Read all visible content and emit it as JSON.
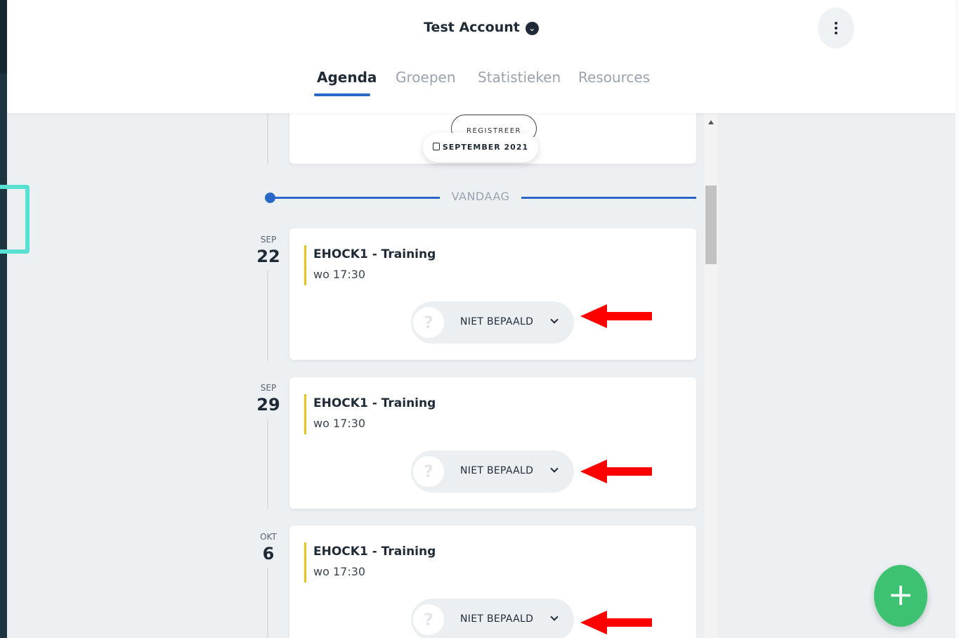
{
  "header": {
    "account_name": "Test Account",
    "account_badge_icon": "chevron-down-circle-icon",
    "more_icon": "more-vertical-icon"
  },
  "tabs": [
    {
      "label": "Agenda",
      "active": true
    },
    {
      "label": "Groepen",
      "active": false
    },
    {
      "label": "Statistieken",
      "active": false
    },
    {
      "label": "Resources",
      "active": false
    }
  ],
  "timeline": {
    "previous_button_label": "REGISTREER",
    "month_pill_label": "SEPTEMBER 2021",
    "today_label": "VANDAAG"
  },
  "events": [
    {
      "month": "SEP",
      "day": "22",
      "title": "EHOCK1 - Training",
      "time": "wo 17:30",
      "status": "NIET BEPAALD",
      "status_icon": "?"
    },
    {
      "month": "SEP",
      "day": "29",
      "title": "EHOCK1 - Training",
      "time": "wo 17:30",
      "status": "NIET BEPAALD",
      "status_icon": "?"
    },
    {
      "month": "OKT",
      "day": "6",
      "title": "EHOCK1 - Training",
      "time": "wo 17:30",
      "status": "NIET BEPAALD",
      "status_icon": "?"
    }
  ],
  "fab": {
    "label": "+"
  },
  "colors": {
    "accent": "#2b67c8",
    "event_bar": "#e6c61d",
    "fab": "#3dc272",
    "annotation_arrow": "#ff0000",
    "annotation_box": "#58e0d1"
  }
}
